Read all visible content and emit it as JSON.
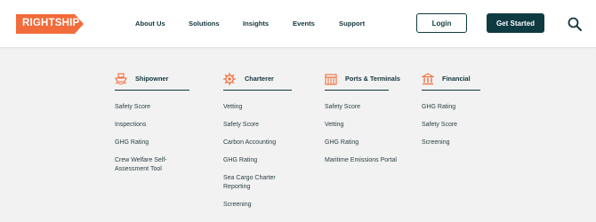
{
  "brand": {
    "name": "RIGHTSHIP",
    "color": "#f26b3a"
  },
  "header": {
    "nav": [
      "About Us",
      "Solutions",
      "Insights",
      "Events",
      "Support"
    ],
    "login_label": "Login",
    "get_started_label": "Get Started",
    "search_icon": "search-icon"
  },
  "menu": {
    "columns": [
      {
        "title": "Shipowner",
        "icon": "ship-icon",
        "links": [
          "Safety Score",
          "Inspections",
          "GHG Rating",
          "Crew Welfare Self-Assessment Tool"
        ]
      },
      {
        "title": "Charterer",
        "icon": "helm-icon",
        "links": [
          "Vetting",
          "Safety Score",
          "Carbon Accounting",
          "GHG Rating",
          "Sea Cargo Charter Reporting",
          "Screening"
        ]
      },
      {
        "title": "Ports & Terminals",
        "icon": "terminal-icon",
        "links": [
          "Safety Score",
          "Vetting",
          "GHG Rating",
          "Maritime Emissions Portal"
        ]
      },
      {
        "title": "Financial",
        "icon": "bank-icon",
        "links": [
          "GHG Rating",
          "Safety Score",
          "Screening"
        ]
      }
    ]
  },
  "colors": {
    "primary": "#0e3a42",
    "accent": "#f26b3a",
    "background": "#f1f2f1"
  }
}
